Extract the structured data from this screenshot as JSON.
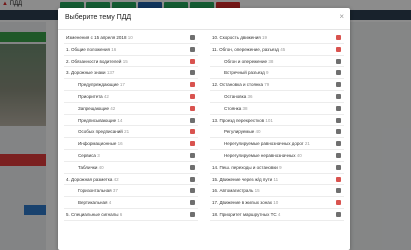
{
  "background": {
    "logo": "ПДД"
  },
  "modal": {
    "title": "Выберите тему ПДД",
    "close": "×",
    "left_column": [
      {
        "label": "Изменения с 15 апреля 2018",
        "count": "10",
        "sub": false,
        "state": "gray"
      },
      {
        "label": "1. Общие положения",
        "count": "16",
        "sub": false,
        "state": "gray"
      },
      {
        "label": "2. Обязанности водителей",
        "count": "15",
        "sub": false,
        "state": "red"
      },
      {
        "label": "3. Дорожные знаки",
        "count": "137",
        "sub": false,
        "state": "gray"
      },
      {
        "label": "Предупреждающие",
        "count": "17",
        "sub": true,
        "state": "red"
      },
      {
        "label": "Приоритета",
        "count": "42",
        "sub": true,
        "state": "red"
      },
      {
        "label": "Запрещающие",
        "count": "42",
        "sub": true,
        "state": "red"
      },
      {
        "label": "Предписывающие",
        "count": "14",
        "sub": true,
        "state": "gray"
      },
      {
        "label": "Особых предписаний",
        "count": "21",
        "sub": true,
        "state": "red"
      },
      {
        "label": "Информационные",
        "count": "16",
        "sub": true,
        "state": "red"
      },
      {
        "label": "Сервиса",
        "count": "3",
        "sub": true,
        "state": "gray"
      },
      {
        "label": "Таблички",
        "count": "40",
        "sub": true,
        "state": "gray"
      },
      {
        "label": "4. Дорожная разметка",
        "count": "42",
        "sub": false,
        "state": "gray"
      },
      {
        "label": "Горизонтальная",
        "count": "37",
        "sub": true,
        "state": "gray"
      },
      {
        "label": "Вертикальная",
        "count": "4",
        "sub": true,
        "state": "gray"
      },
      {
        "label": "5. Специальные сигналы",
        "count": "6",
        "sub": false,
        "state": "gray"
      }
    ],
    "right_column": [
      {
        "label": "10. Скорость движения",
        "count": "19",
        "sub": false,
        "state": "red"
      },
      {
        "label": "11. Обгон, опережение, разъезд",
        "count": "45",
        "sub": false,
        "state": "red"
      },
      {
        "label": "Обгон и опережение",
        "count": "38",
        "sub": true,
        "state": "gray"
      },
      {
        "label": "Встречный разъезд",
        "count": "9",
        "sub": true,
        "state": "gray"
      },
      {
        "label": "12. Остановка и стоянка",
        "count": "79",
        "sub": false,
        "state": "gray"
      },
      {
        "label": "Остановка",
        "count": "36",
        "sub": true,
        "state": "gray"
      },
      {
        "label": "Стоянка",
        "count": "38",
        "sub": true,
        "state": "gray"
      },
      {
        "label": "13. Проезд перекрестков",
        "count": "101",
        "sub": false,
        "state": "gray"
      },
      {
        "label": "Регулируемые",
        "count": "40",
        "sub": true,
        "state": "gray"
      },
      {
        "label": "Нерегулируемые равнозначных дорог",
        "count": "21",
        "sub": true,
        "state": "gray"
      },
      {
        "label": "Нерегулируемые неравнозначных",
        "count": "40",
        "sub": true,
        "state": "gray"
      },
      {
        "label": "14. Пеш. переходы и остановки",
        "count": "9",
        "sub": false,
        "state": "gray"
      },
      {
        "label": "15. Движение через ж/д пути",
        "count": "11",
        "sub": false,
        "state": "red"
      },
      {
        "label": "16. Автомагистраль",
        "count": "15",
        "sub": false,
        "state": "gray"
      },
      {
        "label": "17. Движение в жилых зонах",
        "count": "10",
        "sub": false,
        "state": "red"
      },
      {
        "label": "18. Приоритет маршрутных ТС",
        "count": "4",
        "sub": false,
        "state": "gray"
      }
    ]
  }
}
